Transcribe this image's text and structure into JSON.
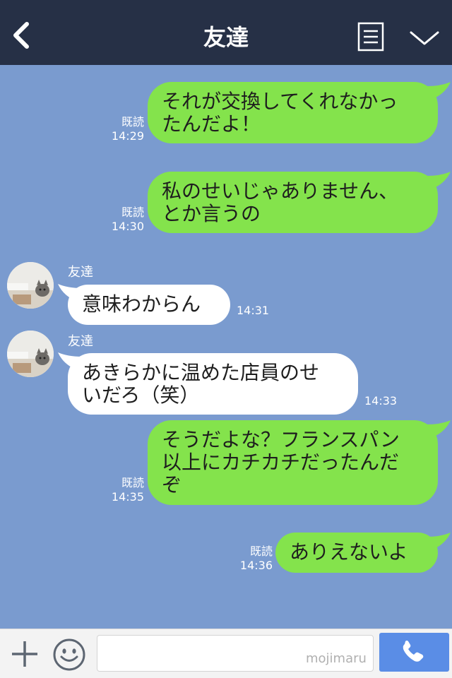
{
  "header": {
    "title": "友達",
    "icons": {
      "back": "chevron-left-icon",
      "menu": "list-icon",
      "collapse": "chevron-down-icon"
    }
  },
  "messages": [
    {
      "direction": "out",
      "text": "それが交換してくれなかっ\nたんだよ！",
      "read": "既読",
      "time": "14:29"
    },
    {
      "direction": "out",
      "text": "私のせいじゃありません、\nとか言うの",
      "read": "既読",
      "time": "14:30"
    },
    {
      "direction": "in",
      "sender": "友達",
      "text": "意味わからん",
      "time": "14:31"
    },
    {
      "direction": "in",
      "sender": "友達",
      "text": "あきらかに温めた店員のせ\nいだろ（笑）",
      "time": "14:33"
    },
    {
      "direction": "out",
      "text": "そうだよな？フランスパン\n以上にカチカチだったんだ\nぞ",
      "read": "既読",
      "time": "14:35"
    },
    {
      "direction": "out",
      "text": "ありえないよ",
      "read": "既読",
      "time": "14:36"
    }
  ],
  "footer": {
    "input_value": "",
    "watermark": "mojimaru",
    "icons": {
      "add": "plus-icon",
      "emoji": "smiley-icon",
      "call": "phone-icon"
    }
  },
  "colors": {
    "header_bg": "#263046",
    "chat_bg": "#7a9bcf",
    "outgoing_bubble": "#84e34c",
    "incoming_bubble": "#ffffff",
    "call_button": "#5a8de6"
  }
}
